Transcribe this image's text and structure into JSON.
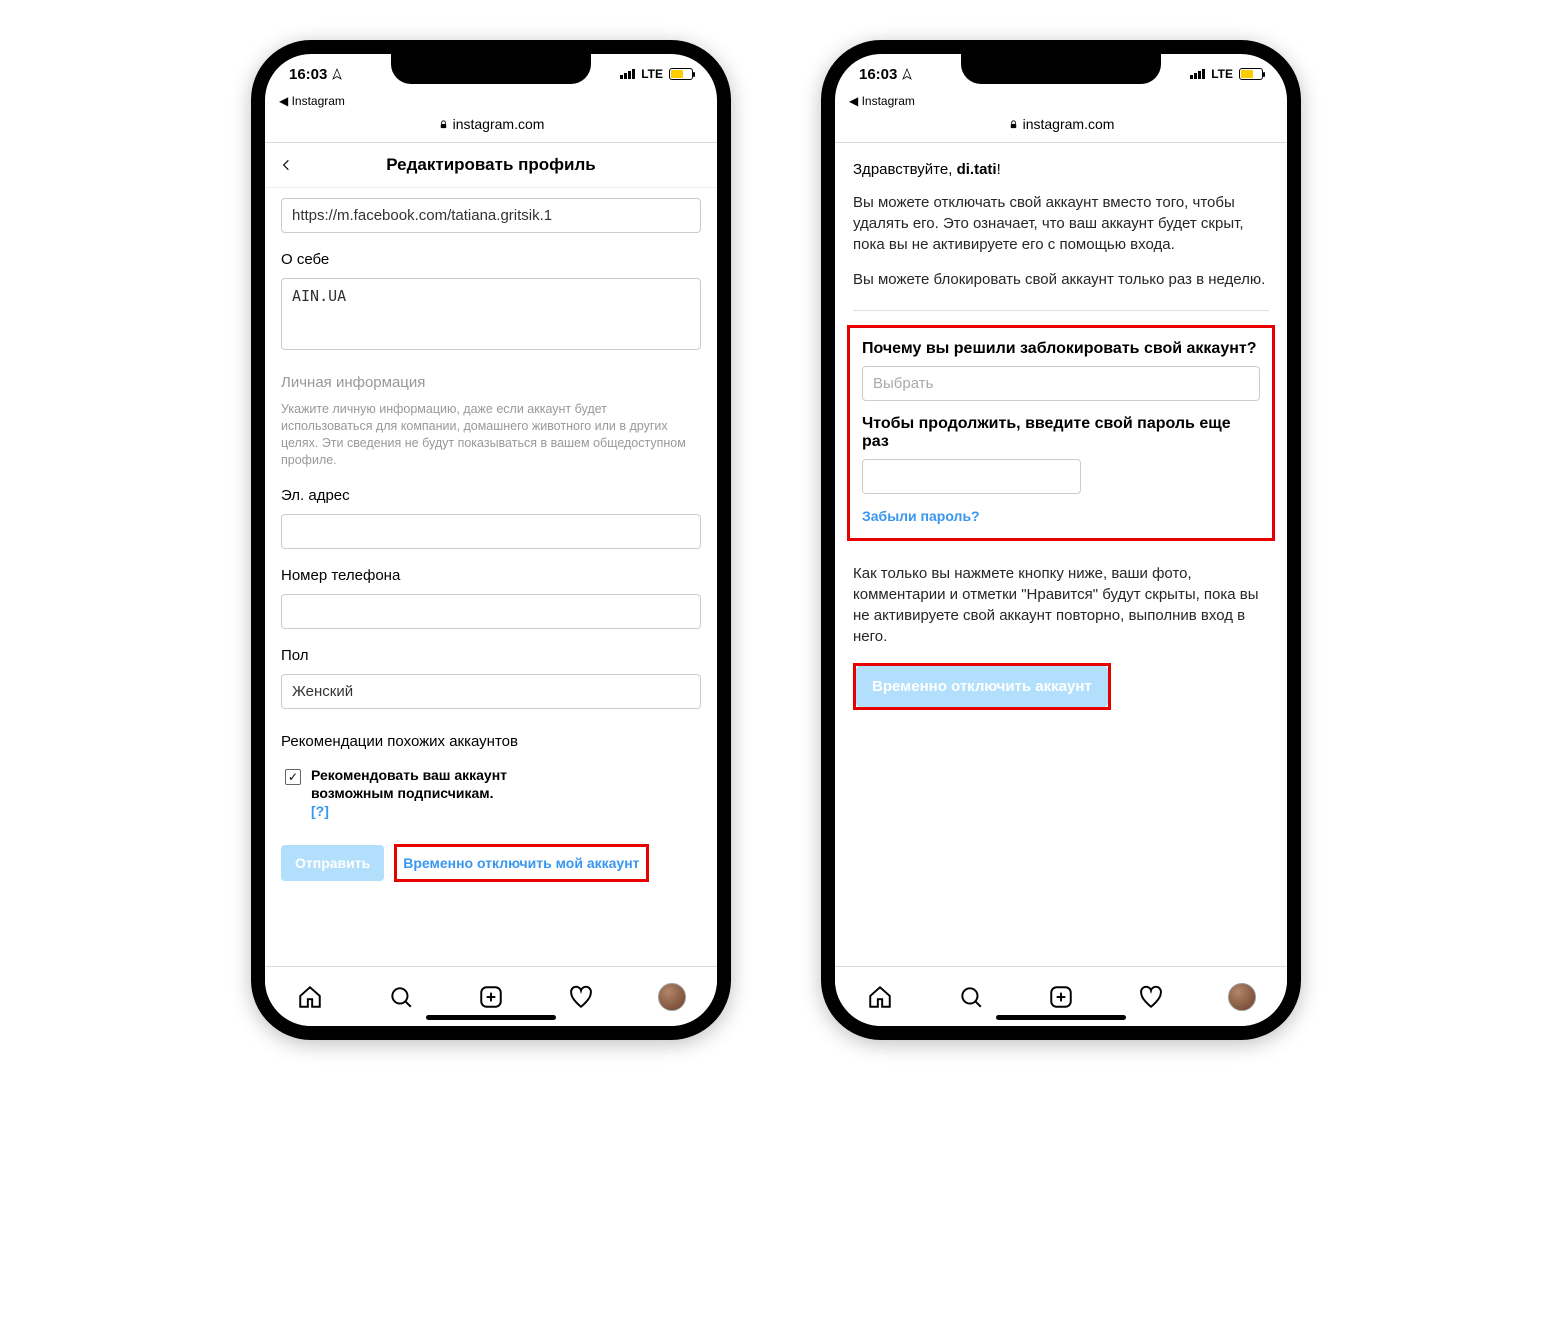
{
  "status": {
    "time": "16:03",
    "back_app": "Instagram",
    "network": "LTE",
    "url": "instagram.com"
  },
  "left": {
    "header_title": "Редактировать профиль",
    "website_value": "https://m.facebook.com/tatiana.gritsik.1",
    "bio_label": "О себе",
    "bio_value": "AIN.UA",
    "personal_info_title": "Личная информация",
    "personal_info_text": "Укажите личную информацию, даже если аккаунт будет использоваться для компании, домашнего животного или в других целях. Эти сведения не будут показываться в вашем общедоступном профиле.",
    "email_label": "Эл. адрес",
    "phone_label": "Номер телефона",
    "gender_label": "Пол",
    "gender_value": "Женский",
    "similar_title": "Рекомендации похожих аккаунтов",
    "similar_check": "Рекомендовать ваш аккаунт возможным подписчикам.",
    "help_q": "[?]",
    "submit_btn": "Отправить",
    "disable_link": "Временно отключить мой аккаунт"
  },
  "right": {
    "greeting_prefix": "Здравствуйте, ",
    "username": "di.tati",
    "greeting_suffix": "!",
    "para1": "Вы можете отключать свой аккаунт вместо того, чтобы удалять его. Это означает, что ваш аккаунт будет скрыт, пока вы не активируете его с помощью входа.",
    "para2": "Вы можете блокировать свой аккаунт только раз в неделю.",
    "reason_q": "Почему вы решили заблокировать свой аккаунт?",
    "reason_placeholder": "Выбрать",
    "pw_q": "Чтобы продолжить, введите свой пароль еще раз",
    "forgot": "Забыли пароль?",
    "para3": "Как только вы нажмете кнопку ниже, ваши фото, комментарии и отметки \"Нравится\" будут скрыты, пока вы не активируете свой аккаунт повторно, выполнив вход в него.",
    "disable_btn": "Временно отключить аккаунт"
  }
}
